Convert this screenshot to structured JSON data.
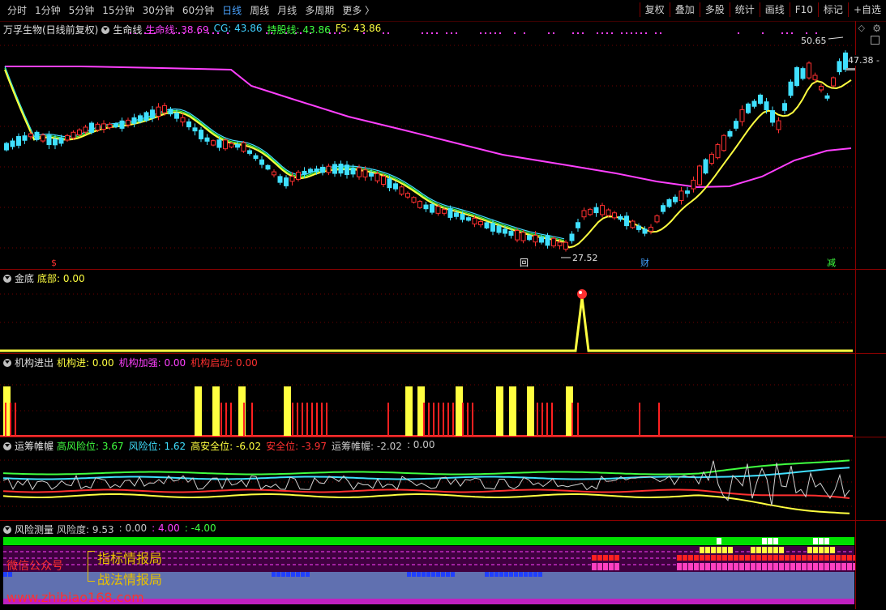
{
  "toolbar": {
    "periods": [
      "分时",
      "1分钟",
      "5分钟",
      "15分钟",
      "30分钟",
      "60分钟",
      "日线",
      "周线",
      "月线",
      "多周期",
      "更多 〉"
    ],
    "active_period": "日线",
    "right_buttons": [
      "复权",
      "叠加",
      "多股",
      "统计",
      "画线",
      "F10",
      "标记",
      "+自选"
    ]
  },
  "main_panel": {
    "title": "万孚生物(日线前复权)",
    "indicator_name": "生命线",
    "readouts": [
      {
        "label": "生命线: 38.69",
        "color": "#ff40ff"
      },
      {
        "label": "CG: 43.86",
        "color": "#40d0ff"
      },
      {
        "label": "持股线: 43.86",
        "color": "#40ff40"
      },
      {
        "label": "FS: 43.86",
        "color": "#ffff40"
      }
    ],
    "high_label": "50.65",
    "low_label": "27.52",
    "price_tag": "47.38 -",
    "markers": [
      {
        "text": "$",
        "color": "#ff3030"
      },
      {
        "text": "回",
        "color": "#ffffff"
      },
      {
        "text": "财",
        "color": "#40a0ff"
      },
      {
        "text": "减",
        "color": "#40ff40"
      }
    ]
  },
  "panel_jindi": {
    "title": "金底",
    "readout": "底部: 0.00",
    "readout_color": "#ffff40"
  },
  "panel_jigou": {
    "title": "机构进出",
    "readouts": [
      {
        "label": "机构进: 0.00",
        "color": "#ffff40"
      },
      {
        "label": "机构加强: 0.00",
        "color": "#ff40ff"
      },
      {
        "label": "机构启动: 0.00",
        "color": "#ff3030"
      }
    ]
  },
  "panel_yunchou": {
    "title": "运筹帷幄",
    "readouts": [
      {
        "label": "高风险位: 3.67",
        "color": "#40ff40"
      },
      {
        "label": "风险位: 1.62",
        "color": "#40e0ff"
      },
      {
        "label": "高安全位: -6.02",
        "color": "#ffff40"
      },
      {
        "label": "安全位: -3.97",
        "color": "#ff3030"
      },
      {
        "label": "运筹帷幄: -2.02",
        "color": "#c8c8c8"
      },
      {
        "label": ": 0.00",
        "color": "#c8c8c8"
      }
    ]
  },
  "panel_fengxian": {
    "title": "风险测量",
    "readouts": [
      {
        "label": "风险度: 9.53",
        "color": "#c8c8c8"
      },
      {
        "label": ": 0.00",
        "color": "#c8c8c8"
      },
      {
        "label": ": 4.00",
        "color": "#ff40ff"
      },
      {
        "label": ": -4.00",
        "color": "#40ff40"
      }
    ]
  },
  "watermark": {
    "wechat": "微信公众号",
    "name1": "指标情报局",
    "name2": "战法情报局",
    "site": "www.zhibiao168.com"
  }
}
